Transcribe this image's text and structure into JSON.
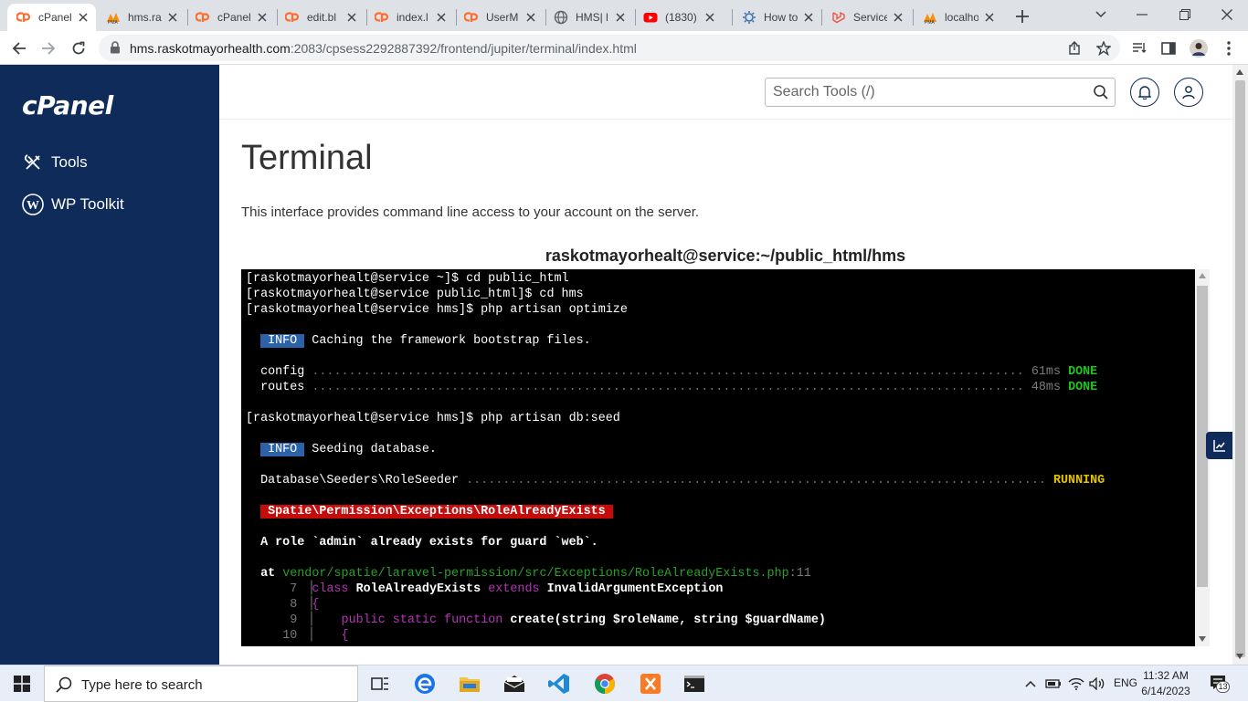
{
  "browser": {
    "tabs": [
      {
        "title": "cPanel",
        "icon": "cpanel-icon",
        "active": true
      },
      {
        "title": "hms.ra",
        "icon": "phpmyadmin-icon"
      },
      {
        "title": "cPanel",
        "icon": "cpanel-icon"
      },
      {
        "title": "edit.bl",
        "icon": "cpanel-icon"
      },
      {
        "title": "index.l",
        "icon": "cpanel-icon"
      },
      {
        "title": "UserM",
        "icon": "cpanel-icon"
      },
      {
        "title": "HMS| l",
        "icon": "globe-icon"
      },
      {
        "title": "(1830)",
        "icon": "youtube-icon"
      },
      {
        "title": "How to",
        "icon": "gear-icon"
      },
      {
        "title": "Service",
        "icon": "laravel-icon"
      },
      {
        "title": "localho",
        "icon": "phpmyadmin-icon"
      }
    ],
    "url_host": "hms.raskotmayorhealth.com",
    "url_path": ":2083/cpsess2292887392/frontend/jupiter/terminal/index.html"
  },
  "sidebar": {
    "logo": "cPanel",
    "items": [
      {
        "label": "Tools",
        "icon": "tools-icon"
      },
      {
        "label": "WP Toolkit",
        "icon": "wordpress-icon"
      }
    ]
  },
  "header": {
    "search_placeholder": "Search Tools (/)"
  },
  "main": {
    "title": "Terminal",
    "description": "This interface provides command line access to your account on the server.",
    "terminal_title": "raskotmayorhealt@service:~/public_html/hms"
  },
  "terminal": {
    "l1": "[raskotmayorhealt@service ~]$ cd public_html",
    "l2": "[raskotmayorhealt@service public_html]$ cd hms",
    "l3": "[raskotmayorhealt@service hms]$ php artisan optimize",
    "info1_badge": "INFO",
    "info1_text": "Caching the framework bootstrap files.",
    "config_label": "config",
    "config_dots": ".................................................................................................",
    "config_time": "61ms",
    "config_status": "DONE",
    "routes_label": "routes",
    "routes_dots": ".................................................................................................",
    "routes_time": "48ms",
    "routes_status": "DONE",
    "l4": "[raskotmayorhealt@service hms]$ php artisan db:seed",
    "info2_badge": "INFO",
    "info2_text": "Seeding database.",
    "seeder_label": "Database\\Seeders\\RoleSeeder",
    "seeder_dots": "...............................................................................",
    "seeder_status": "RUNNING",
    "exception": "Spatie\\Permission\\Exceptions\\RoleAlreadyExists",
    "message": "A role `admin` already exists for guard `web`.",
    "at": "at",
    "at_path": "vendor/spatie/laravel-permission/src/Exceptions/RoleAlreadyExists.php",
    "at_line": ":11",
    "code": [
      {
        "num": "7",
        "kw1": "class",
        "name": "RoleAlreadyExists",
        "kw2": "extends",
        "rest": "InvalidArgumentException"
      },
      {
        "num": "8",
        "text": "{"
      },
      {
        "num": "9",
        "kw": "public static function",
        "name": "create",
        "rest": "(string $roleName, string $guardName)"
      },
      {
        "num": "10",
        "text": "{"
      }
    ]
  },
  "taskbar": {
    "search_placeholder": "Type here to search",
    "language": "ENG",
    "time": "11:32 AM",
    "date": "6/14/2023",
    "notification_count": "13"
  }
}
